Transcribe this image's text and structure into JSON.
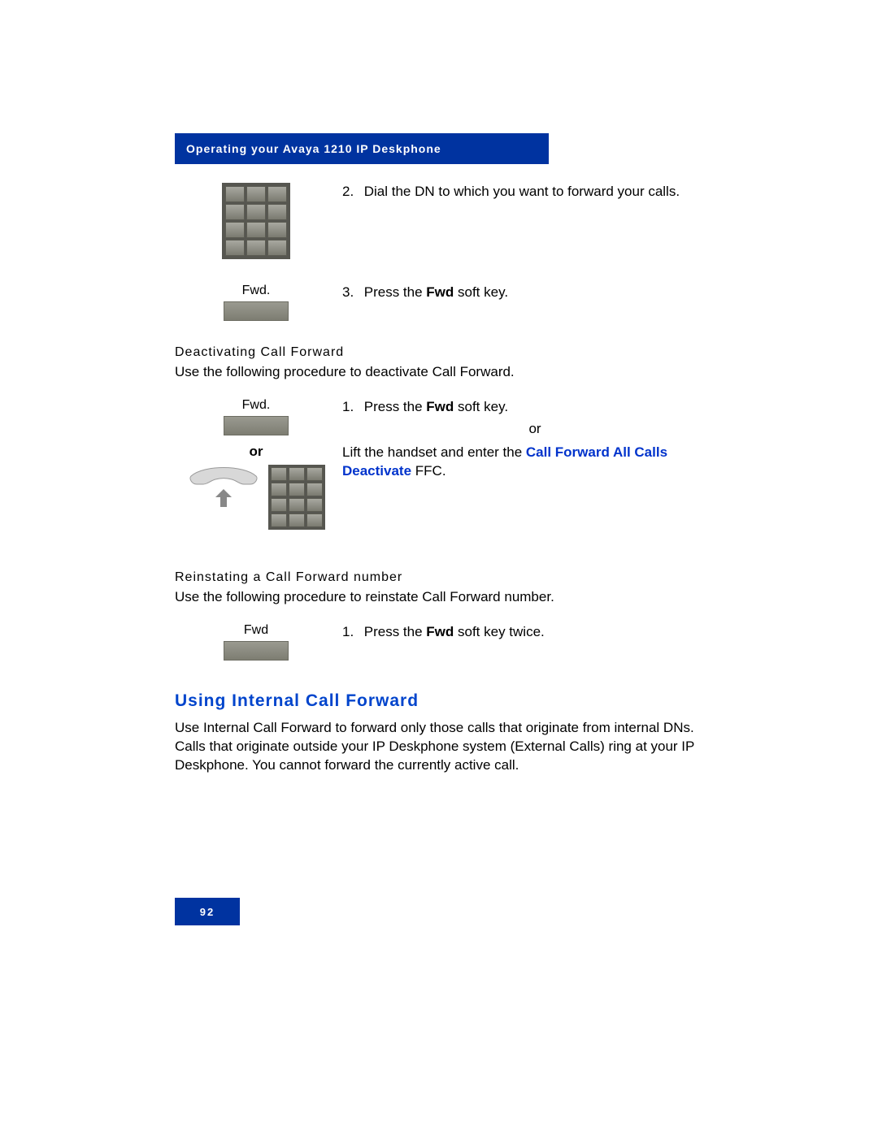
{
  "header": {
    "title": "Operating your Avaya 1210 IP Deskphone"
  },
  "steps_a": {
    "s2_num": "2.",
    "s2_text": "Dial the DN to which you want to forward your calls.",
    "s3_label": "Fwd.",
    "s3_num": "3.",
    "s3_pre": "Press the ",
    "s3_bold": "Fwd",
    "s3_post": " soft key."
  },
  "deact": {
    "heading": "Deactivating Call Forward",
    "intro": "Use the following procedure to deactivate Call Forward.",
    "s1_label": "Fwd.",
    "s1_num": "1.",
    "s1_pre": "Press the ",
    "s1_bold": "Fwd",
    "s1_post": " soft key.",
    "or1": "or",
    "or2": "or",
    "s1b_pre": "Lift the handset and enter the ",
    "s1b_bold": "Call Forward All Calls Deactivate",
    "s1b_post": " FFC."
  },
  "reinst": {
    "heading": "Reinstating a Call Forward number",
    "intro": "Use the following procedure to reinstate Call Forward number.",
    "s1_label": "Fwd",
    "s1_num": "1.",
    "s1_pre": "Press the ",
    "s1_bold": "Fwd",
    "s1_post": " soft key twice."
  },
  "internal": {
    "heading": "Using Internal Call Forward",
    "body": "Use Internal Call Forward to forward only those calls that originate from internal DNs. Calls that originate outside your IP Deskphone system (External Calls) ring at your IP Deskphone. You cannot forward the currently active call."
  },
  "footer": {
    "page": "92"
  }
}
